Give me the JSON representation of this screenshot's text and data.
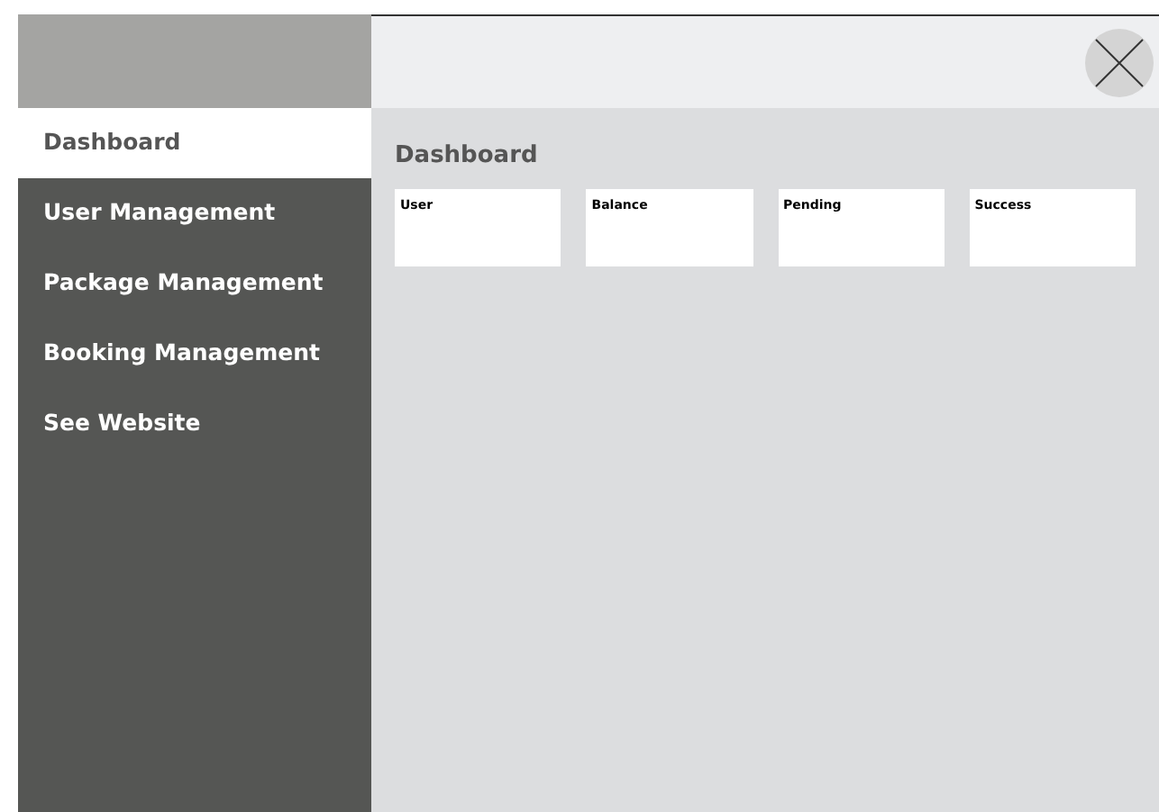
{
  "sidebar": {
    "items": [
      {
        "label": "Dashboard",
        "selected": true
      },
      {
        "label": "User Management",
        "selected": false
      },
      {
        "label": "Package Management",
        "selected": false
      },
      {
        "label": "Booking Management",
        "selected": false
      },
      {
        "label": "See Website",
        "selected": false
      }
    ]
  },
  "main": {
    "title": "Dashboard",
    "cards": [
      {
        "label": "User"
      },
      {
        "label": "Balance"
      },
      {
        "label": "Pending"
      },
      {
        "label": "Success"
      }
    ]
  }
}
